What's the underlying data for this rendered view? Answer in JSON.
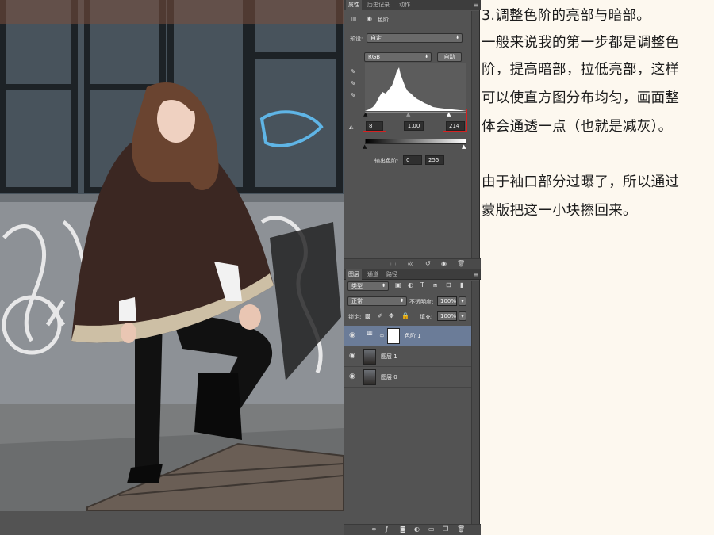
{
  "panel_tabs": {
    "properties": "属性",
    "history": "历史记录",
    "actions": "动作",
    "menu_glyph": "≡"
  },
  "properties": {
    "adjustment_name": "色阶",
    "preset_label": "预设:",
    "preset_value": "自定",
    "channel_value": "RGB",
    "auto_button": "自动",
    "input_black": "8",
    "input_gamma": "1.00",
    "input_white": "214",
    "output_label": "输出色阶:",
    "output_black": "0",
    "output_white": "255"
  },
  "layers_tabs": {
    "layers": "图层",
    "channels": "通道",
    "paths": "路径"
  },
  "layers": {
    "filter_kind": "类型",
    "blend_mode": "正常",
    "opacity_label": "不透明度:",
    "opacity_value": "100%",
    "lock_label": "锁定:",
    "fill_label": "填充:",
    "fill_value": "100%",
    "rows": [
      {
        "name": "色阶 1"
      },
      {
        "name": "图层 1"
      },
      {
        "name": "图层 0"
      }
    ]
  },
  "tutorial": {
    "lines": [
      "3.调整色阶的亮部与暗部。",
      "一般来说我的第一步都是调整色",
      "阶，提高暗部，拉低亮部，这样",
      "可以使直方图分布均匀，画面整",
      "体会通透一点（也就是减灰）。",
      "由于袖口部分过曝了，所以通过",
      "蒙版把这一小块擦回来。"
    ]
  },
  "colors": {
    "accent_red": "#d62020",
    "selected_layer": "#6b7c98",
    "panel_bg": "#535353"
  }
}
